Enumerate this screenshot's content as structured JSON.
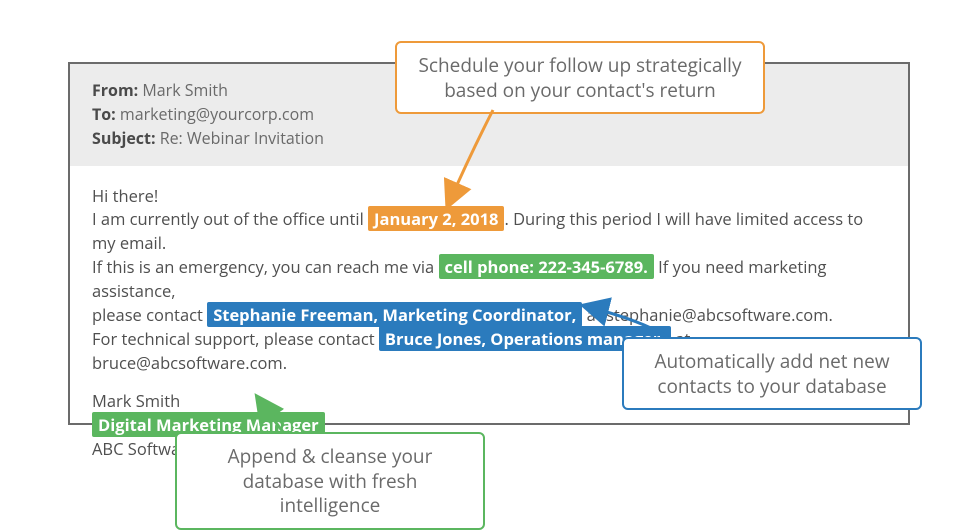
{
  "email": {
    "header": {
      "from_label": "From:",
      "from_value": "Mark Smith",
      "to_label": "To:",
      "to_value": "marketing@yourcorp.com",
      "subject_label": "Subject:",
      "subject_value": "Re: Webinar Invitation"
    },
    "body": {
      "greeting": "Hi there!",
      "p1_a": "I am currently out of the office until ",
      "return_date": "January 2, 2018",
      "p1_b": ". During this period I will have limited access to my email.",
      "p2_a": "If this is an emergency, you can reach me via ",
      "cell": "cell phone: 222-345-6789.",
      "p2_b": " If you need marketing assistance,",
      "p3_a": "please contact ",
      "contact1": "Stephanie Freeman, Marketing Coordinator,",
      "p3_b": " at stephanie@abcsoftware.com.",
      "p4_a": "For technical support, please contact ",
      "contact2": "Bruce Jones, Operations manager,",
      "p4_b": " at bruce@abcsoftware.com."
    },
    "signature": {
      "name": "Mark Smith",
      "title": "Digital Marketing Manager",
      "company": "ABC Software"
    }
  },
  "callouts": {
    "orange": "Schedule your follow up strategically based on your contact's return",
    "blue": "Automatically add net new contacts to your database",
    "green": "Append & cleanse your database with fresh intelligence"
  },
  "colors": {
    "orange": "#ee9a3a",
    "green": "#5bb65f",
    "blue": "#2b7bbd"
  }
}
